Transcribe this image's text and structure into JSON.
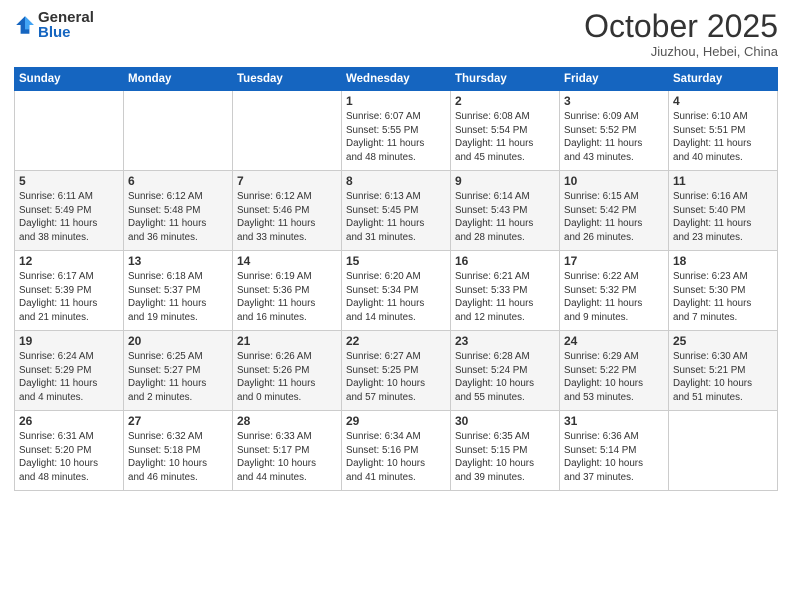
{
  "logo": {
    "general": "General",
    "blue": "Blue"
  },
  "header": {
    "month": "October 2025",
    "location": "Jiuzhou, Hebei, China"
  },
  "weekdays": [
    "Sunday",
    "Monday",
    "Tuesday",
    "Wednesday",
    "Thursday",
    "Friday",
    "Saturday"
  ],
  "weeks": [
    [
      {
        "day": "",
        "info": ""
      },
      {
        "day": "",
        "info": ""
      },
      {
        "day": "",
        "info": ""
      },
      {
        "day": "1",
        "info": "Sunrise: 6:07 AM\nSunset: 5:55 PM\nDaylight: 11 hours\nand 48 minutes."
      },
      {
        "day": "2",
        "info": "Sunrise: 6:08 AM\nSunset: 5:54 PM\nDaylight: 11 hours\nand 45 minutes."
      },
      {
        "day": "3",
        "info": "Sunrise: 6:09 AM\nSunset: 5:52 PM\nDaylight: 11 hours\nand 43 minutes."
      },
      {
        "day": "4",
        "info": "Sunrise: 6:10 AM\nSunset: 5:51 PM\nDaylight: 11 hours\nand 40 minutes."
      }
    ],
    [
      {
        "day": "5",
        "info": "Sunrise: 6:11 AM\nSunset: 5:49 PM\nDaylight: 11 hours\nand 38 minutes."
      },
      {
        "day": "6",
        "info": "Sunrise: 6:12 AM\nSunset: 5:48 PM\nDaylight: 11 hours\nand 36 minutes."
      },
      {
        "day": "7",
        "info": "Sunrise: 6:12 AM\nSunset: 5:46 PM\nDaylight: 11 hours\nand 33 minutes."
      },
      {
        "day": "8",
        "info": "Sunrise: 6:13 AM\nSunset: 5:45 PM\nDaylight: 11 hours\nand 31 minutes."
      },
      {
        "day": "9",
        "info": "Sunrise: 6:14 AM\nSunset: 5:43 PM\nDaylight: 11 hours\nand 28 minutes."
      },
      {
        "day": "10",
        "info": "Sunrise: 6:15 AM\nSunset: 5:42 PM\nDaylight: 11 hours\nand 26 minutes."
      },
      {
        "day": "11",
        "info": "Sunrise: 6:16 AM\nSunset: 5:40 PM\nDaylight: 11 hours\nand 23 minutes."
      }
    ],
    [
      {
        "day": "12",
        "info": "Sunrise: 6:17 AM\nSunset: 5:39 PM\nDaylight: 11 hours\nand 21 minutes."
      },
      {
        "day": "13",
        "info": "Sunrise: 6:18 AM\nSunset: 5:37 PM\nDaylight: 11 hours\nand 19 minutes."
      },
      {
        "day": "14",
        "info": "Sunrise: 6:19 AM\nSunset: 5:36 PM\nDaylight: 11 hours\nand 16 minutes."
      },
      {
        "day": "15",
        "info": "Sunrise: 6:20 AM\nSunset: 5:34 PM\nDaylight: 11 hours\nand 14 minutes."
      },
      {
        "day": "16",
        "info": "Sunrise: 6:21 AM\nSunset: 5:33 PM\nDaylight: 11 hours\nand 12 minutes."
      },
      {
        "day": "17",
        "info": "Sunrise: 6:22 AM\nSunset: 5:32 PM\nDaylight: 11 hours\nand 9 minutes."
      },
      {
        "day": "18",
        "info": "Sunrise: 6:23 AM\nSunset: 5:30 PM\nDaylight: 11 hours\nand 7 minutes."
      }
    ],
    [
      {
        "day": "19",
        "info": "Sunrise: 6:24 AM\nSunset: 5:29 PM\nDaylight: 11 hours\nand 4 minutes."
      },
      {
        "day": "20",
        "info": "Sunrise: 6:25 AM\nSunset: 5:27 PM\nDaylight: 11 hours\nand 2 minutes."
      },
      {
        "day": "21",
        "info": "Sunrise: 6:26 AM\nSunset: 5:26 PM\nDaylight: 11 hours\nand 0 minutes."
      },
      {
        "day": "22",
        "info": "Sunrise: 6:27 AM\nSunset: 5:25 PM\nDaylight: 10 hours\nand 57 minutes."
      },
      {
        "day": "23",
        "info": "Sunrise: 6:28 AM\nSunset: 5:24 PM\nDaylight: 10 hours\nand 55 minutes."
      },
      {
        "day": "24",
        "info": "Sunrise: 6:29 AM\nSunset: 5:22 PM\nDaylight: 10 hours\nand 53 minutes."
      },
      {
        "day": "25",
        "info": "Sunrise: 6:30 AM\nSunset: 5:21 PM\nDaylight: 10 hours\nand 51 minutes."
      }
    ],
    [
      {
        "day": "26",
        "info": "Sunrise: 6:31 AM\nSunset: 5:20 PM\nDaylight: 10 hours\nand 48 minutes."
      },
      {
        "day": "27",
        "info": "Sunrise: 6:32 AM\nSunset: 5:18 PM\nDaylight: 10 hours\nand 46 minutes."
      },
      {
        "day": "28",
        "info": "Sunrise: 6:33 AM\nSunset: 5:17 PM\nDaylight: 10 hours\nand 44 minutes."
      },
      {
        "day": "29",
        "info": "Sunrise: 6:34 AM\nSunset: 5:16 PM\nDaylight: 10 hours\nand 41 minutes."
      },
      {
        "day": "30",
        "info": "Sunrise: 6:35 AM\nSunset: 5:15 PM\nDaylight: 10 hours\nand 39 minutes."
      },
      {
        "day": "31",
        "info": "Sunrise: 6:36 AM\nSunset: 5:14 PM\nDaylight: 10 hours\nand 37 minutes."
      },
      {
        "day": "",
        "info": ""
      }
    ]
  ]
}
